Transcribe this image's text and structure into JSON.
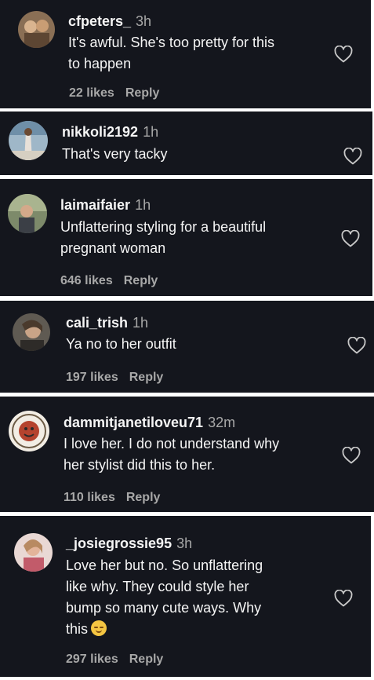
{
  "comments": [
    {
      "username": "cfpeters_",
      "time": "3h",
      "text_lines": [
        "It's awful. She's too pretty for this",
        "to happen"
      ],
      "likes": "22 likes",
      "reply": "Reply"
    },
    {
      "username": "nikkoli2192",
      "time": "1h",
      "text_lines": [
        "That's very tacky"
      ],
      "likes": "",
      "reply": ""
    },
    {
      "username": "laimaifaier",
      "time": "1h",
      "text_lines": [
        "Unflattering styling for a beautiful",
        "pregnant woman"
      ],
      "likes": "646 likes",
      "reply": "Reply"
    },
    {
      "username": "cali_trish",
      "time": "1h",
      "text_lines": [
        "Ya no to her outfit"
      ],
      "likes": "197 likes",
      "reply": "Reply"
    },
    {
      "username": "dammitjanetiloveu71",
      "time": "32m",
      "text_lines": [
        "I love her. I do not understand why",
        "her stylist did this to her."
      ],
      "likes": "110 likes",
      "reply": "Reply"
    },
    {
      "username": "_josiegrossie95",
      "time": "3h",
      "text_lines": [
        "Love her but no. So unflattering",
        "like why. They could style her",
        "bump so many cute ways. Why",
        "this"
      ],
      "likes": "297 likes",
      "reply": "Reply"
    }
  ],
  "colors": {
    "card_bg": "#14161d",
    "primary_text": "#f5f5f5",
    "secondary_text": "#a8a8a8",
    "separator": "#ffffff"
  },
  "icons": {
    "like": "heart-outline-icon",
    "emoji": "pensive-face-emoji"
  }
}
